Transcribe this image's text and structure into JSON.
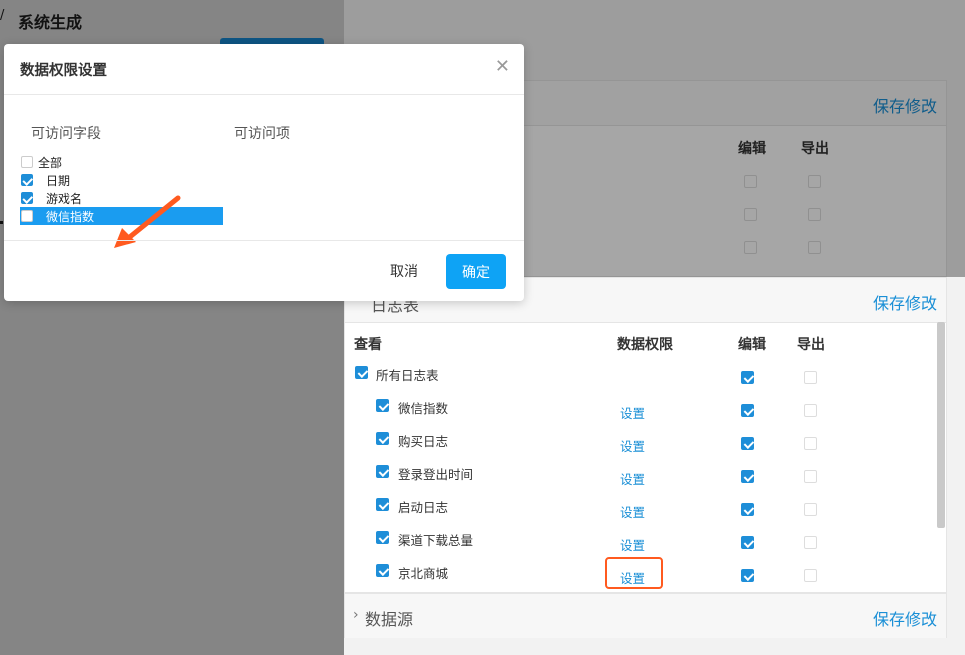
{
  "page": {
    "title": "系统生成"
  },
  "panels": {
    "save_label": "保存修改",
    "log_header_partial": "日志表",
    "bottom_title": "数据源",
    "top_columns": {
      "edit": "编辑",
      "export": "导出"
    },
    "log_columns": {
      "view": "查看",
      "data_perm": "数据权限",
      "edit": "编辑",
      "export": "导出"
    },
    "log_all_label": "所有日志表",
    "set_label": "设置",
    "log_rows": [
      {
        "label": "微信指数",
        "checked": true,
        "edit": true,
        "export": false
      },
      {
        "label": "购买日志",
        "checked": true,
        "edit": true,
        "export": false
      },
      {
        "label": "登录登出时间",
        "checked": true,
        "edit": true,
        "export": false
      },
      {
        "label": "启动日志",
        "checked": true,
        "edit": true,
        "export": false
      },
      {
        "label": "渠道下载总量",
        "checked": true,
        "edit": true,
        "export": false
      },
      {
        "label": "京北商城",
        "checked": true,
        "edit": true,
        "export": false
      }
    ]
  },
  "modal": {
    "title": "数据权限设置",
    "accessible_fields_label": "可访问字段",
    "accessible_items_label": "可访问项",
    "fields": [
      {
        "label": "全部",
        "checked": false
      },
      {
        "label": "日期",
        "checked": true
      },
      {
        "label": "游戏名",
        "checked": true
      },
      {
        "label": "微信指数",
        "checked": false,
        "selected": true
      }
    ],
    "cancel_label": "取消",
    "ok_label": "确定"
  },
  "colors": {
    "accent": "#1a9cf0",
    "link": "#1a8fd6",
    "annotation": "#ff5a1f"
  }
}
